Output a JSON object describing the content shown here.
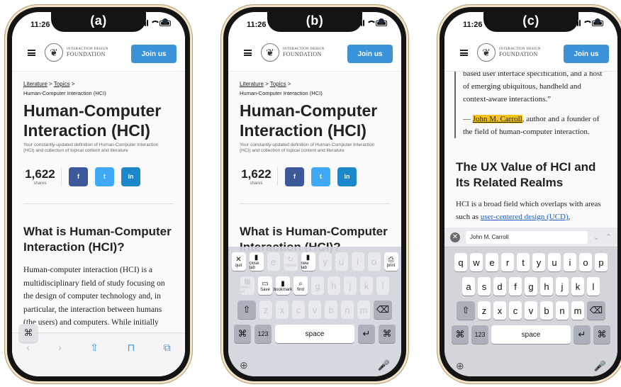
{
  "panels": {
    "a": {
      "label": "(a)"
    },
    "b": {
      "label": "(b)"
    },
    "c": {
      "label": "(c)"
    }
  },
  "status": {
    "time": "11:26"
  },
  "header": {
    "logo_line1": "INTERACTION DESIGN",
    "logo_line2": "FOUNDATION",
    "join_label": "Join us"
  },
  "breadcrumb": {
    "literature": "Literature",
    "sep": ">",
    "topics": "Topics",
    "sub": "Human-Computer Interaction (HCI)"
  },
  "article": {
    "title": "Human-Computer Interaction (HCI)",
    "subtitle": "Your constantly-updated definition of Human-Computer Interaction (HCI) and collection of topical content and literature",
    "shares_count": "1,622",
    "shares_label": "shares",
    "section_heading": "What is Human-Computer Interaction (HCI)?",
    "body": "Human-computer interaction (HCI) is a multidisciplinary field of study focusing on the design of computer technology and, in particular, the interaction between humans (the users) and computers. While initially concerned with computers, HCI has since"
  },
  "social": {
    "facebook": "f",
    "twitter": "t",
    "linkedin": "in"
  },
  "colors": {
    "join": "#3a93d8",
    "facebook": "#3b5998",
    "twitter": "#3fa9f5",
    "linkedin": "#1c87c9",
    "highlight": "#f6c31c"
  },
  "panel_c": {
    "quote_start": "based user interface specification, and a host of emerging ubiquitous, handheld and context-aware interactions.”",
    "attribution_dash": "—",
    "author": "John M. Carroll",
    "attribution_rest": ", author and a founder of the field of human-computer interaction.",
    "heading": "The UX Value of HCI and Its Related Realms",
    "para_start": "HCI is a broad field which overlaps with areas such as ",
    "para_link": "user-centered design (UCD)",
    "para_end": ",",
    "suggestion": "John M. Carroll"
  },
  "keyboard": {
    "row1": [
      "q",
      "w",
      "e",
      "r",
      "t",
      "y",
      "u",
      "i",
      "o",
      "p"
    ],
    "row2": [
      "a",
      "s",
      "d",
      "f",
      "g",
      "h",
      "j",
      "k",
      "l"
    ],
    "row3": [
      "z",
      "x",
      "c",
      "v",
      "b",
      "n",
      "m"
    ],
    "shift": "⇧",
    "backspace": "⌫",
    "cmd": "⌘",
    "num": "123",
    "space": "space",
    "return": "↵",
    "globe": "⊕",
    "mic": "🎤"
  },
  "shortcuts": {
    "row1": [
      {
        "icon": "✕",
        "label": "quit"
      },
      {
        "icon": "▮",
        "label": "close tab"
      },
      {
        "icon": "↻",
        "label": "reload"
      },
      {
        "icon": "▮",
        "label": "new tab"
      }
    ],
    "row1_print": {
      "icon": "⎙",
      "label": "print"
    },
    "row2": [
      {
        "icon": "▦",
        "label": "select all"
      },
      {
        "icon": "▭",
        "label": "Save"
      },
      {
        "icon": "▮",
        "label": "bookmark"
      },
      {
        "icon": "⌕",
        "label": "find"
      }
    ]
  },
  "toolbar": {
    "back": "‹",
    "forward": "›",
    "share": "⇧",
    "bookmarks": "⊓",
    "tabs": "⧉"
  }
}
